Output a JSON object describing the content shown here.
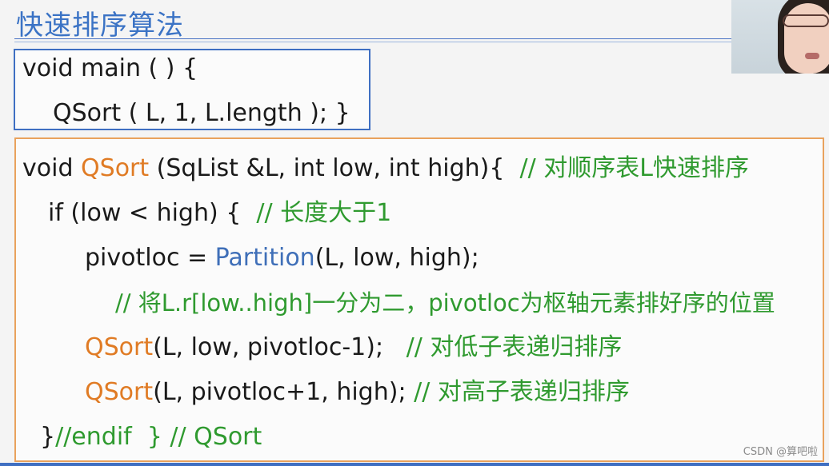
{
  "slide": {
    "title": "快速排序算法"
  },
  "main_box": {
    "line1": "void main ( ) {",
    "line2": "QSort ( L, 1, L.length ); }"
  },
  "qsort": {
    "l1_a": "void ",
    "l1_fn": "QSort",
    "l1_b": " (SqList &L, int low, int high){  ",
    "l1_c": "// 对顺序表L快速排序",
    "l2_a": "if (low < high) {  ",
    "l2_c": "// 长度大于1",
    "l3_a": "pivotloc = ",
    "l3_fn": "Partition",
    "l3_b": "(L, low, high);",
    "l4_c": "// 将L.r[low..high]一分为二，pivotloc为枢轴元素排好序的位置",
    "l5_fn": "QSort",
    "l5_b": "(L, low, pivotloc-1);   ",
    "l5_c": "// 对低子表递归排序",
    "l6_fn": "QSort",
    "l6_b": "(L, pivotloc+1, high); ",
    "l6_c": "// 对高子表递归排序",
    "l7_a": "}",
    "l7_c": "//endif  } // QSort"
  },
  "watermark": "CSDN @算吧啦",
  "colors": {
    "title": "#3b73c5",
    "function_highlight": "#e07b24",
    "partition_highlight": "#3f6fb8",
    "comment": "#2f9a2f",
    "main_box_border": "#3f6fc2",
    "qsort_box_border": "#e9a25d"
  }
}
